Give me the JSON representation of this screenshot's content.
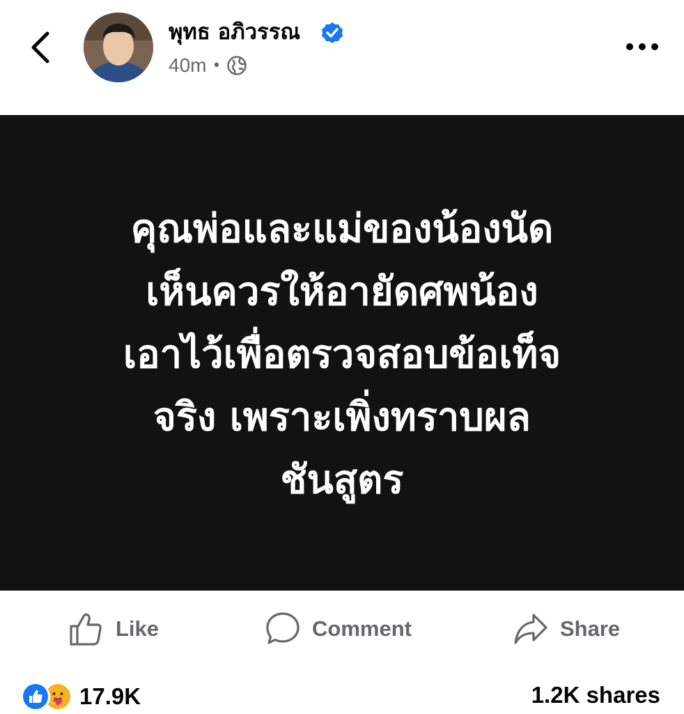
{
  "post": {
    "author_name": "พุทธ อภิวรรณ",
    "time": "40m",
    "separator": "•",
    "audience_icon": "globe-icon",
    "verified_icon": "verified-badge-icon",
    "text_lines": [
      "คุณพ่อและแม่ของน้องนัด",
      "เห็นควรให้อายัดศพน้อง",
      "เอาไว้เพื่อตรวจสอบข้อเท็จ",
      "จริง เพราะเพิ่งทราบผล",
      "ชันสูตร"
    ]
  },
  "actions": {
    "like_label": "Like",
    "comment_label": "Comment",
    "share_label": "Share"
  },
  "stats": {
    "reaction_count": "17.9K",
    "shares": "1.2K shares",
    "reaction_icons": [
      "like-reaction-icon",
      "care-reaction-icon"
    ]
  },
  "colors": {
    "brand_blue": "#1877f2",
    "image_background": "#121212",
    "secondary_text": "#65676b"
  }
}
